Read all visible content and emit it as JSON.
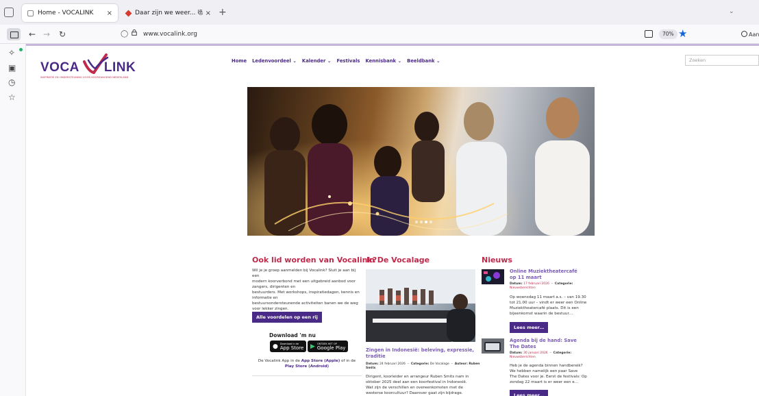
{
  "browser": {
    "tabs": [
      {
        "title": "Home - VOCALINK",
        "close": "×"
      },
      {
        "title": "Daar zijn we weer... 😻",
        "close": "×"
      }
    ],
    "new_tab": "+",
    "url": "www.vocalink.org",
    "zoom": "70%",
    "account_label": "Aan"
  },
  "site": {
    "logo_left": "VOCA",
    "logo_right": "LINK",
    "logo_tagline": "INSPIRATIE EN ONDERSTEUNING VOOR KOORZANGEND NEDERLAND",
    "nav": [
      "Home",
      "Ledenvoordeel ⌄",
      "Kalender ⌄",
      "Festivals",
      "Kennisbank ⌄",
      "Beeldbank ⌄"
    ],
    "search_placeholder": "Zoeken"
  },
  "member": {
    "title": "Ook lid worden van Vocalink?",
    "lines": [
      "Wil je je groep aanmelden bij Vocalink? Sluit je aan bij een",
      "modern koorverbond met een uitgebreid aanbod voor zangers, dirigenten en",
      "bestuurders. Met workshops, inspiratiedagen, kennis en informatie en",
      "bestuursondersteunende activiteiten banen we de weg voor lekker zingen.",
      "Vaak met een aantrekkelijke korting."
    ],
    "button": "Alle voordelen op een rij",
    "download_title": "Download 'm nu",
    "appstore_small": "Download in de",
    "appstore_big": "App Store",
    "play_small": "ONTDEK HET OP",
    "play_big": "Google Play",
    "app_text_1": "De Vocalink App in de ",
    "app_text_store": "App Store (Apple)",
    "app_text_2": " of in de ",
    "app_text_play": "Play Store (Android)"
  },
  "vocalage": {
    "title": "In De Vocalage",
    "article_title": "Zingen in Indonesië: beleving, expressie, traditie",
    "date_label": "Datum:",
    "date": "24 februari 2026",
    "cat_label": "Categorie:",
    "cat": "De Vocalage",
    "author_label": "Auteur:",
    "author": "Ruben Smits",
    "lines": [
      "Dirigent, koorleider en arrangeur Ruben Smits nam in",
      "oktober 2025 deel aan een koorfestival in Indonesië.",
      "Wat zijn de verschillen en overeenkomsten met de",
      "westerse koorcultuur? Daarover gaat zijn bijdrage."
    ]
  },
  "news": {
    "title": "Nieuws",
    "items": [
      {
        "title": "Online Muziektheatercafé op 11 maart",
        "date_label": "Datum:",
        "date": "17 februari 2026",
        "cat_label": "Categorie:",
        "cat": "Nieuwsberichten",
        "lines": [
          "Op woensdag 11 maart a.s. – van 19.30",
          "tot 21.00 uur – vindt er weer een Online",
          "Muziektheatercafé plaats. Dit is een",
          "bijeenkomst waarin de bestuur…"
        ],
        "button": "Lees meer…"
      },
      {
        "title": "Agenda bij de hand: Save The Dates",
        "date_label": "Datum:",
        "date": "30 januari 2026",
        "cat_label": "Categorie:",
        "cat": "Nieuwsberichten",
        "lines": [
          "Heb je de agenda binnen handbereik?",
          "We hebben namelijk een paar Save",
          "The Dates voor je. Eerst de festivals: Op",
          "zondag 22 maart is er weer een e…"
        ],
        "button": "Lees meer…"
      }
    ]
  }
}
